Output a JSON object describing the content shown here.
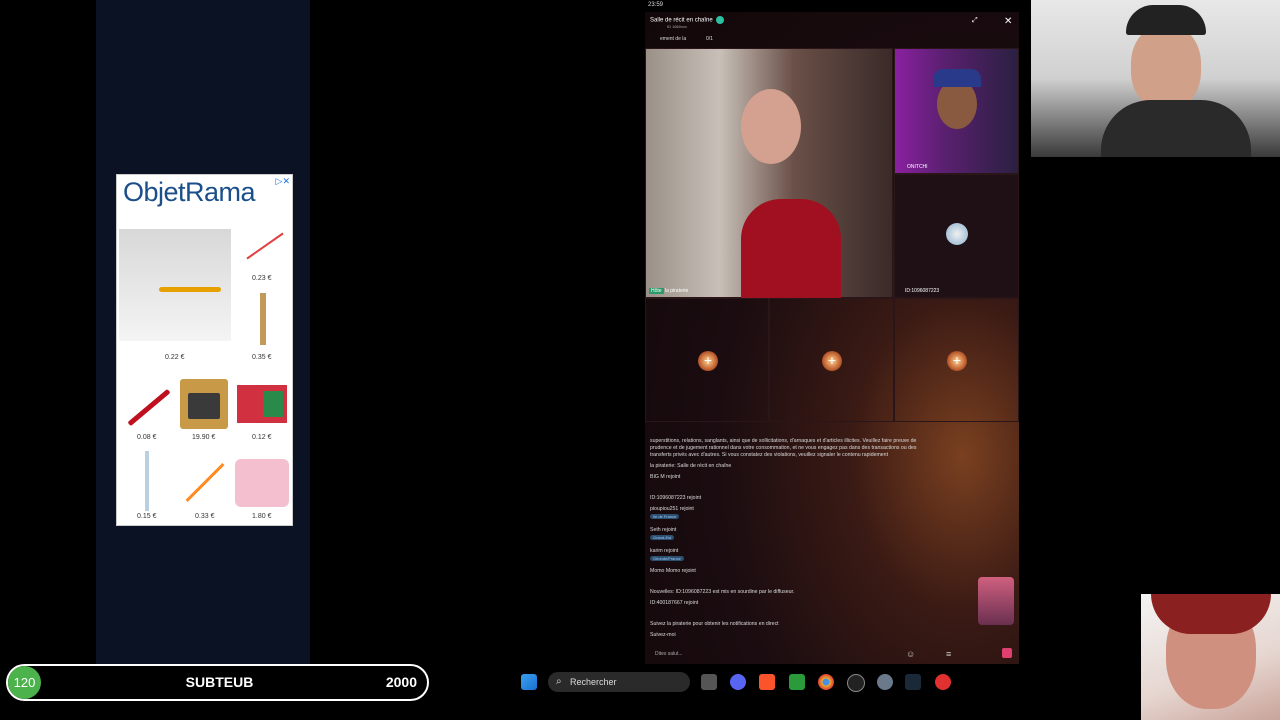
{
  "ad": {
    "brand": "ObjetRama",
    "adchoices": "▷✕",
    "prices": [
      "0.23 €",
      "0.22 €",
      "0.35 €",
      "0.08 €",
      "19.90 €",
      "0.12 €",
      "0.15 €",
      "0.33 €",
      "1.80 €"
    ]
  },
  "app": {
    "status_time": "23:59",
    "room_title": "Salle de récit en chaîne",
    "room_sub": "ID 1660xxx",
    "header_tab": "ement de la",
    "header_counter": "0/1",
    "host_label": "la piraterie",
    "host_badge": "Hôte",
    "guest_label": "ONITCHI",
    "empty_seat_label": "ID:1096087223",
    "chat": {
      "lines": [
        "superstitions, relations, sanglants, ainsi que de sollicitations, d'arnaques et d'articles illicites. Veuillez faire preuve de",
        "prudence et de jugement rationnel dans votre consommation, et ne vous engagez pas dans des transactions ou des",
        "transferts privés avec d'autres. Si vous constatez des violations, veuillez signaler le contenu rapidement",
        "la piraterie: Salle de récit en chaîne",
        "BIG M rejoint",
        "ID:1096087223 rejoint",
        "pioupiou251 rejoint",
        "Seth rejoint",
        "karim rejoint",
        "Momo Momo rejoint",
        "Nouvelles: ID:1096087223 est mis en sourdine par le diffuseur.",
        "ID:400187667 rejoint",
        "Suivez la piraterie pour obtenir les notifications en direct",
        "Suivez-moi"
      ],
      "chips": [
        "Ile de France",
        "Grand-Est",
        "Gironde/France"
      ],
      "input_placeholder": "Dites salut..."
    }
  },
  "goal": {
    "current": "120",
    "name": "SUBTEUB",
    "target": "2000"
  },
  "taskbar": {
    "search_label": "Rechercher"
  }
}
